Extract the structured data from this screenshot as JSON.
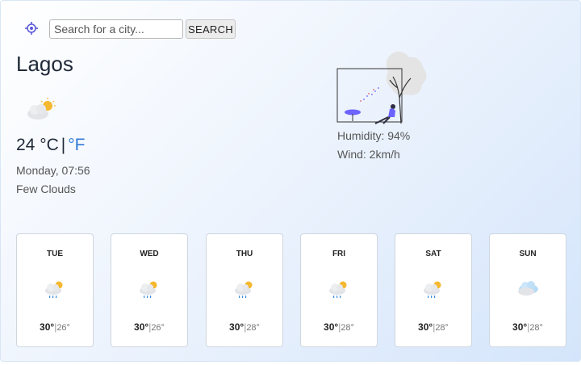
{
  "search": {
    "placeholder": "Search for a city...",
    "button_label": "SEARCH"
  },
  "current": {
    "city": "Lagos",
    "temp_c": "24 °C",
    "separator": "|",
    "unit_f": "°F",
    "date": "Monday, 07:56",
    "description": "Few Clouds",
    "humidity": "Humidity: 94%",
    "wind": "Wind: 2km/h",
    "icon": "partly-cloudy-icon"
  },
  "forecast": [
    {
      "day": "TUE",
      "high": "30°",
      "low": "26°",
      "icon": "cloud-sun-rain-icon"
    },
    {
      "day": "WED",
      "high": "30°",
      "low": "26°",
      "icon": "cloud-sun-rain-icon"
    },
    {
      "day": "THU",
      "high": "30°",
      "low": "28°",
      "icon": "cloud-sun-rain-icon"
    },
    {
      "day": "FRI",
      "high": "30°",
      "low": "28°",
      "icon": "cloud-sun-rain-icon"
    },
    {
      "day": "SAT",
      "high": "30°",
      "low": "28°",
      "icon": "cloud-sun-rain-icon"
    },
    {
      "day": "SUN",
      "high": "30°",
      "low": "28°",
      "icon": "cloud-icon"
    }
  ],
  "colors": {
    "accent": "#2f7ad6",
    "sun": "#f5b82e",
    "cloud": "#e6e8eb",
    "illustration": "#6c63ff"
  }
}
